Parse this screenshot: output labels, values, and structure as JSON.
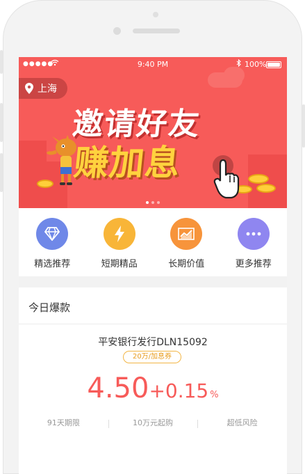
{
  "status_bar": {
    "signal": "●●●●●",
    "time": "9:40 PM",
    "battery": "100%"
  },
  "location": {
    "city": "上海",
    "icon": "map-pin-icon"
  },
  "banner": {
    "headline_top": "邀请好友",
    "headline_bottom": "赚加息",
    "page_count": 3,
    "active_page": 0
  },
  "categories": [
    {
      "label": "精选推荐",
      "icon": "diamond-icon",
      "color": "#6f88e8"
    },
    {
      "label": "短期精品",
      "icon": "lightning-icon",
      "color": "#f8b538"
    },
    {
      "label": "长期价值",
      "icon": "growth-chart-icon",
      "color": "#f7943b"
    },
    {
      "label": "更多推荐",
      "icon": "more-dots-icon",
      "color": "#8f86f0"
    }
  ],
  "hot_card": {
    "title": "今日爆款",
    "product_name": "平安银行发行DLN15092",
    "tag": "20万/加息券",
    "rate_base": "4.50",
    "rate_bonus": "+0.15",
    "rate_unit": "%",
    "term": "91天期限",
    "min_invest": "10万元起购",
    "risk": "超低风险"
  },
  "colors": {
    "brand_red": "#f75b59",
    "accent_gold": "#ffd23e"
  }
}
